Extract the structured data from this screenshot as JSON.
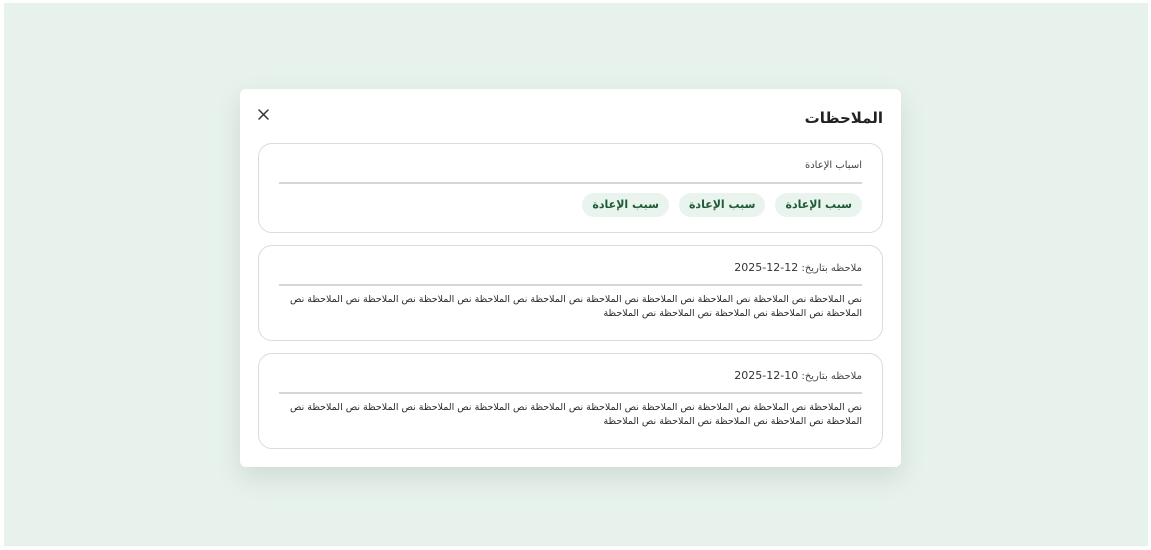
{
  "modal": {
    "title": "الملاحظات",
    "close_icon": "close-icon"
  },
  "reasons": {
    "label": "اسباب الإعادة",
    "chips": [
      "سبب الإعادة",
      "سبب الإعادة",
      "سبب الإعادة"
    ]
  },
  "notes": [
    {
      "date_label": "ملاحظه بتاريخ:",
      "date": "12-12-2025",
      "text": "نص الملاحظة نص الملاحظة نص الملاحظة نص الملاحظة نص الملاحظة نص الملاحظة نص الملاحظة نص الملاحظة نص الملاحظة نص الملاحظة نص الملاحظة نص الملاحظة نص الملاحظة نص الملاحظة نص الملاحظة"
    },
    {
      "date_label": "ملاحظه بتاريخ:",
      "date": "10-12-2025",
      "text": "نص الملاحظة نص الملاحظة نص الملاحظة نص الملاحظة نص الملاحظة نص الملاحظة نص الملاحظة نص الملاحظة نص الملاحظة نص الملاحظة نص الملاحظة نص الملاحظة نص الملاحظة نص الملاحظة نص الملاحظة"
    }
  ],
  "colors": {
    "backdrop": "#e6f2eb",
    "chip_bg": "#eaf4ee",
    "chip_text": "#1e5a34"
  }
}
